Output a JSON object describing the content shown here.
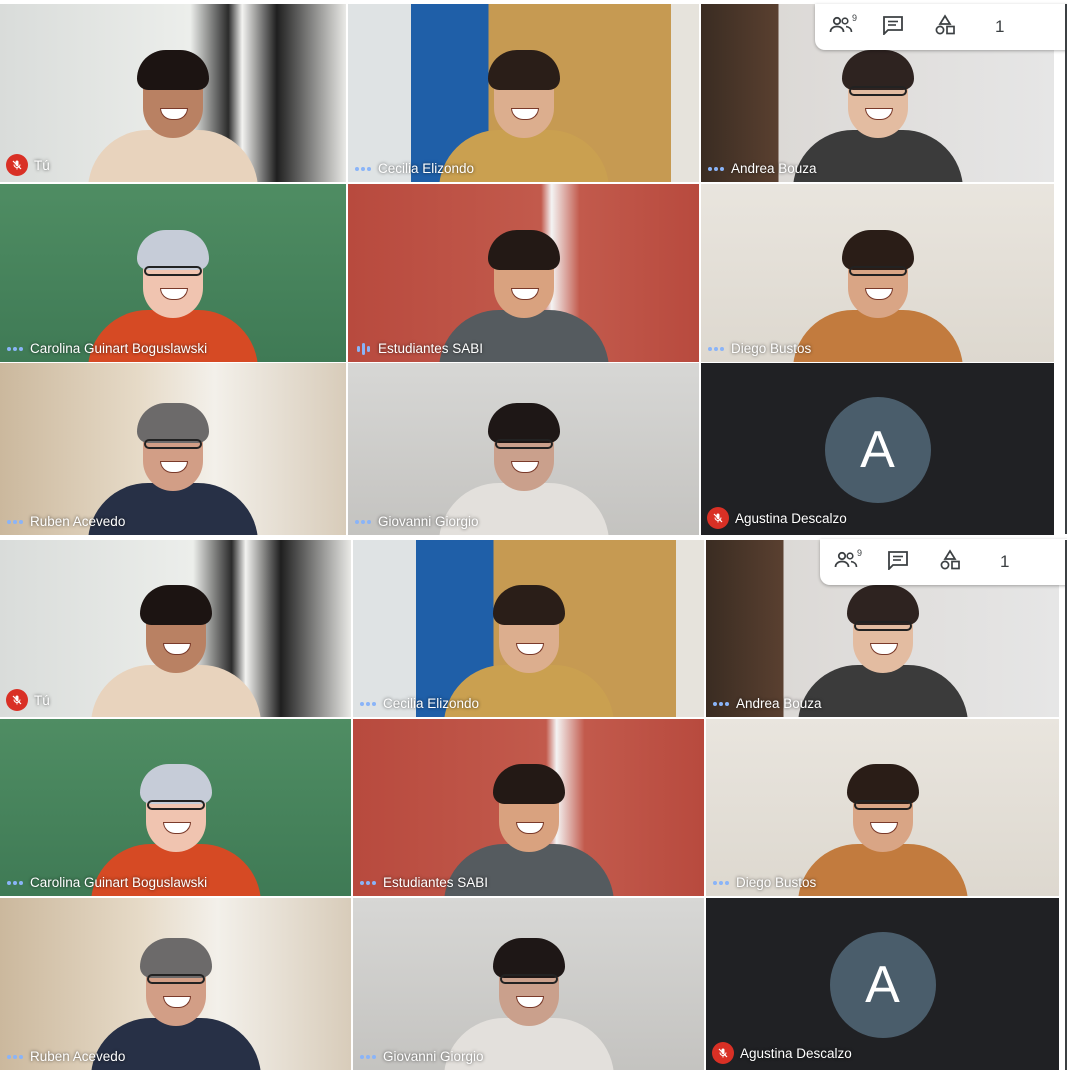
{
  "meeting": {
    "toolbar": {
      "people_count": "9",
      "clock_partial": "1"
    },
    "captures": [
      {
        "participants": [
          {
            "name": "Tú",
            "status": "muted",
            "scene": "curtain"
          },
          {
            "name": "Cecilia Elizondo",
            "status": "dots",
            "scene": "door-blue"
          },
          {
            "name": "Andrea Bouza",
            "status": "dots",
            "scene": "bookshelf"
          },
          {
            "name": "Carolina Guinart Boguslawski",
            "status": "dots",
            "scene": "green-wall"
          },
          {
            "name": "Estudiantes SABI",
            "status": "speaking",
            "scene": "red-wall"
          },
          {
            "name": "Diego Bustos",
            "status": "dots",
            "scene": "white-wall"
          },
          {
            "name": "Ruben Acevedo",
            "status": "dots",
            "scene": "window-bright"
          },
          {
            "name": "Giovanni Giorgio",
            "status": "dots",
            "scene": "grey-room"
          },
          {
            "name": "Agustina Descalzo",
            "status": "muted",
            "scene": "avatar",
            "initial": "A"
          }
        ]
      },
      {
        "participants": [
          {
            "name": "Tú",
            "status": "muted",
            "scene": "curtain"
          },
          {
            "name": "Cecilia Elizondo",
            "status": "dots",
            "scene": "door-blue"
          },
          {
            "name": "Andrea Bouza",
            "status": "dots",
            "scene": "bookshelf"
          },
          {
            "name": "Carolina Guinart Boguslawski",
            "status": "dots",
            "scene": "green-wall"
          },
          {
            "name": "Estudiantes SABI",
            "status": "dots",
            "scene": "red-wall"
          },
          {
            "name": "Diego Bustos",
            "status": "dots",
            "scene": "white-wall"
          },
          {
            "name": "Ruben Acevedo",
            "status": "dots",
            "scene": "window-bright"
          },
          {
            "name": "Giovanni Giorgio",
            "status": "dots",
            "scene": "grey-room"
          },
          {
            "name": "Agustina Descalzo",
            "status": "muted",
            "scene": "avatar",
            "initial": "A"
          }
        ]
      }
    ],
    "colors": {
      "muted_badge": "#d93025",
      "speaking_indicator": "#8ab4f8",
      "avatar_bg": "#4a5d6b",
      "empty_tile_bg": "#202124"
    }
  }
}
